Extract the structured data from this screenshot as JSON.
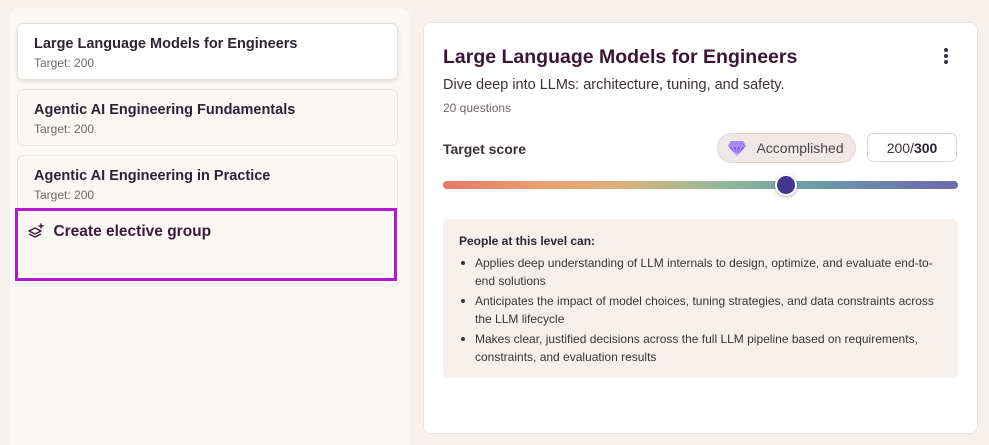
{
  "courses": [
    {
      "title": "Large Language Models for Engineers",
      "target": "Target: 200"
    },
    {
      "title": "Agentic AI Engineering Fundamentals",
      "target": "Target: 200"
    },
    {
      "title": "Agentic AI Engineering in Practice",
      "target": "Target: 200"
    }
  ],
  "create_group": {
    "label": "Create elective group",
    "icon": "layers-plus-icon"
  },
  "detail": {
    "title": "Large Language Models for Engineers",
    "description": "Dive deep into LLMs: architecture, tuning, and safety.",
    "question_count": "20 questions",
    "target_label": "Target score",
    "badge": {
      "label": "Accomplished",
      "icon": "gem-icon",
      "color": "#8b5cf6"
    },
    "score": {
      "value": "200",
      "separator": "/",
      "total": "300"
    },
    "slider": {
      "value": 200,
      "min": 0,
      "max": 300
    },
    "level": {
      "heading": "People at this level can:",
      "items": [
        "Applies deep understanding of LLM internals to design, optimize, and evaluate end-to-end solutions",
        "Anticipates the impact of model choices, tuning strategies, and data constraints across the LLM lifecycle",
        "Makes clear, justified decisions across the full LLM pipeline based on requirements, constraints, and evaluation results"
      ]
    }
  },
  "colors": {
    "accent_border": "#b319d1",
    "slider_thumb": "#403890"
  }
}
